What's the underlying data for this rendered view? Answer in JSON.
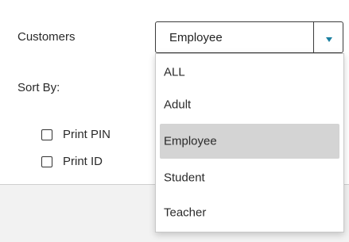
{
  "form": {
    "customers_label": "Customers",
    "sort_by_label": "Sort By:",
    "customers_select": {
      "value": "Employee",
      "arrow_color": "#1a7fa0"
    },
    "checkboxes": [
      {
        "label": "Print PIN",
        "checked": false
      },
      {
        "label": "Print ID",
        "checked": false
      }
    ]
  },
  "dropdown": {
    "options": [
      "ALL",
      "Adult",
      "Employee",
      "Student",
      "Teacher"
    ],
    "selected": "Employee",
    "highlight_color": "#d4d4d4"
  }
}
